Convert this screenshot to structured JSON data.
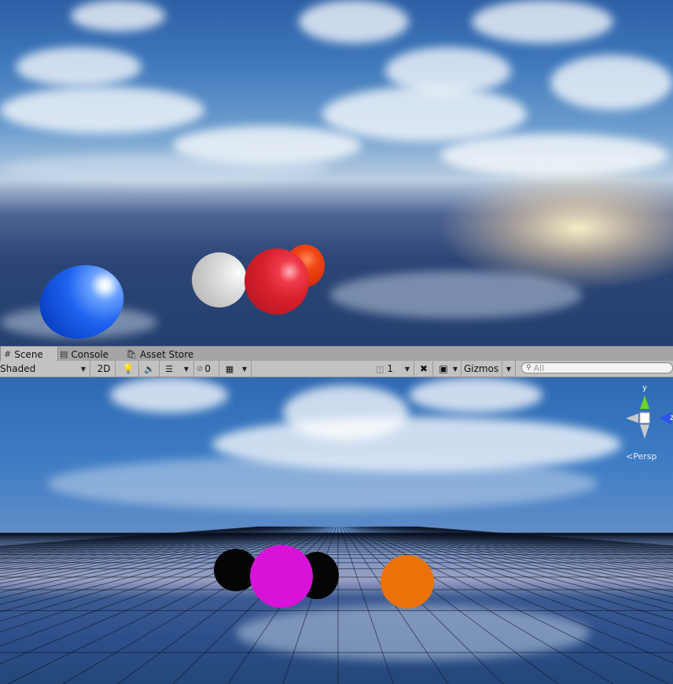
{
  "tabs": [
    {
      "label": "Scene",
      "icon": "grid-hash-icon",
      "active": true
    },
    {
      "label": "Console",
      "icon": "console-icon",
      "active": false
    },
    {
      "label": "Asset Store",
      "icon": "shopping-bag-icon",
      "active": false
    }
  ],
  "toolbar": {
    "shading_mode": "Shaded",
    "mode_2d": "2D",
    "effects_hidden_count": "0",
    "layer_count": "1",
    "gizmos_label": "Gizmos",
    "search_placeholder": "All"
  },
  "scene_view": {
    "projection_label": "Persp",
    "axis_y": "y",
    "axis_z": "z"
  },
  "colors": {
    "sphere_blue": "#1f63f0",
    "sphere_white": "#dcdcdc",
    "sphere_red": "#d8202c",
    "sphere_orange": "#d93209",
    "sphere_magenta": "#d812d8",
    "sphere_black": "#050505",
    "sphere_orange_flat": "#ea7208",
    "gizmo_y": "#6cd42a",
    "gizmo_z": "#2a55e8"
  }
}
